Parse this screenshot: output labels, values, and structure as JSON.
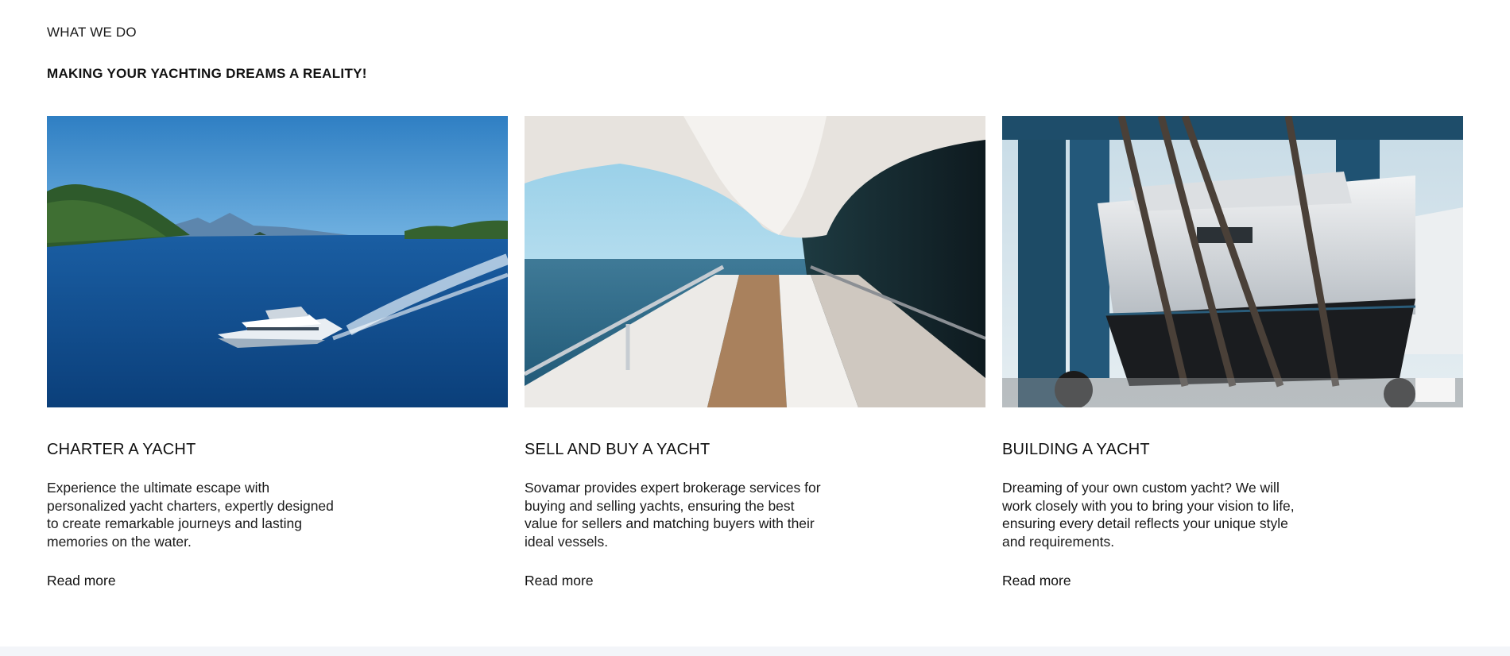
{
  "section": {
    "eyebrow": "WHAT WE DO",
    "headline": "MAKING YOUR YACHTING DREAMS A REALITY!"
  },
  "cards": [
    {
      "title": "CHARTER A YACHT",
      "description": "Experience the ultimate escape with personalized yacht charters, expertly designed to create remarkable journeys and lasting memories on the water.",
      "link": "Read more",
      "image_alt": "Motor yacht cruising on deep blue sea near green islands"
    },
    {
      "title": "SELL AND BUY A YACHT",
      "description": "Sovamar provides expert brokerage services for buying and selling yachts, ensuring the best value for sellers and matching buyers with their ideal vessels.",
      "link": "Read more",
      "image_alt": "Yacht side deck with teak walkway and railing overlooking the sea"
    },
    {
      "title": "BUILDING A YACHT",
      "description": "Dreaming of your own custom yacht? We will work closely with you to bring your vision to life, ensuring every detail reflects your unique style and requirements.",
      "link": "Read more",
      "image_alt": "Yacht hull lifted by a travel lift in a shipyard"
    }
  ],
  "colors": {
    "sea_blue": "#0f4f8c",
    "sky_blue": "#3d86c6",
    "band_bg": "#f3f5f9"
  }
}
